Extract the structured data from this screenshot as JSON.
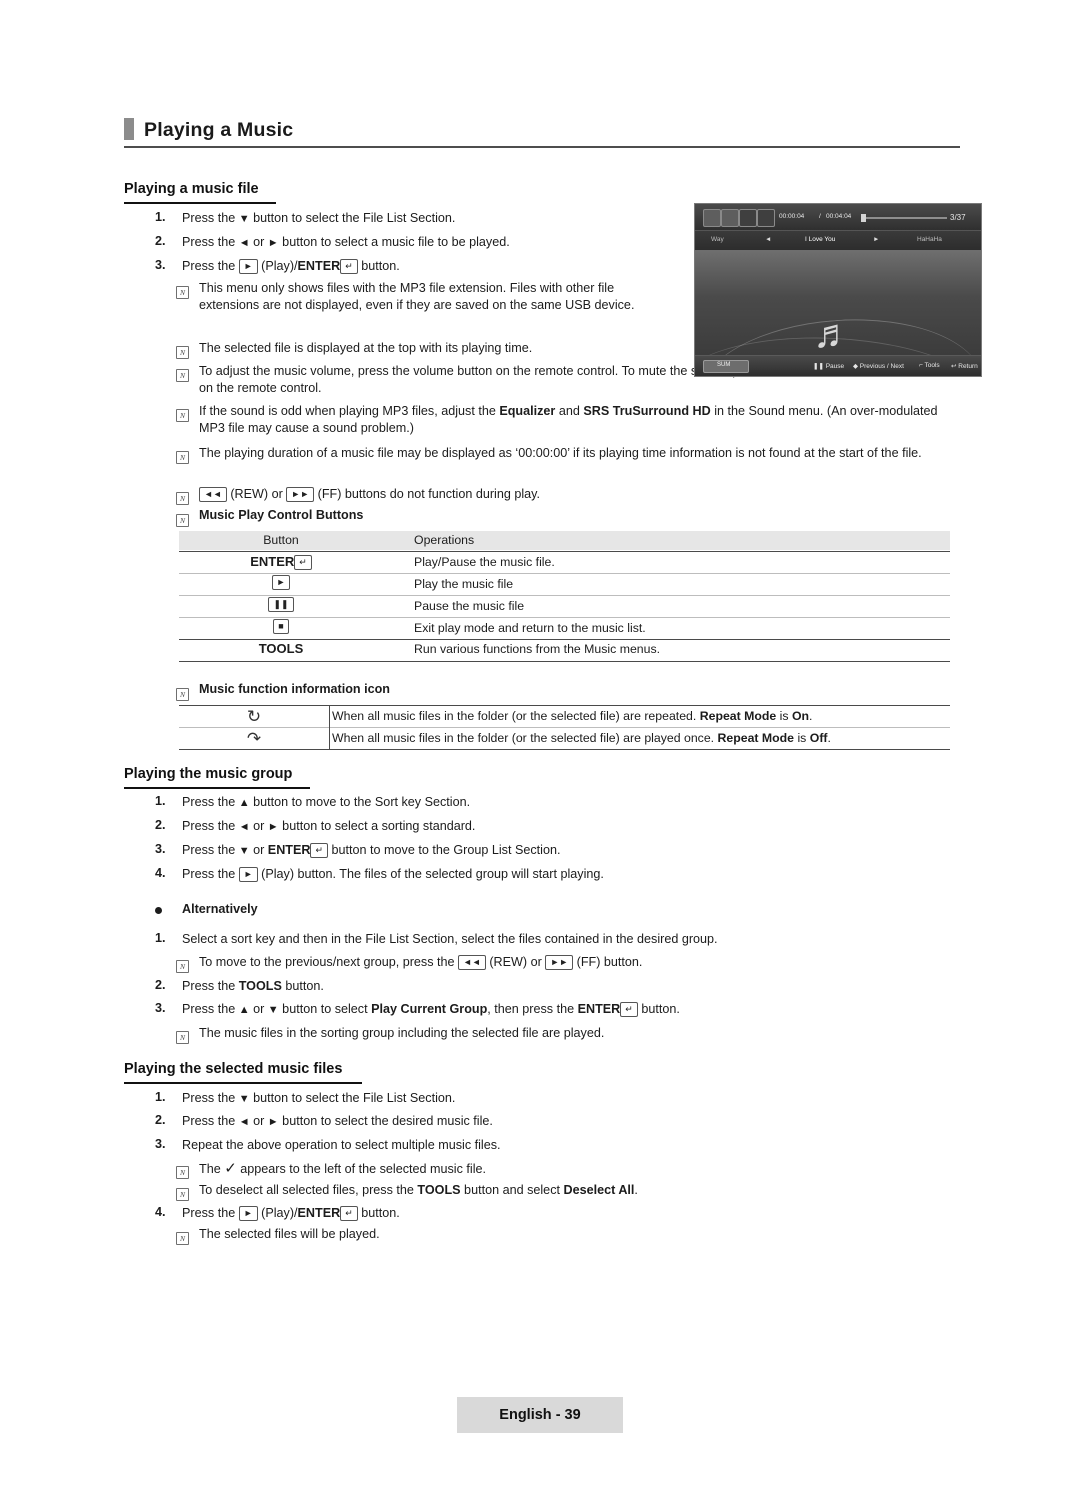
{
  "page": {
    "title": "Playing a Music",
    "footer_label": "English - 39"
  },
  "sections": {
    "music_file": {
      "heading": "Playing a music file",
      "steps": [
        "Press the ▼ button to select the File List Section.",
        "Press the ◄ or ► button to select a music file to be played.",
        "Press the ► (Play)/ENTER button."
      ],
      "notes": [
        "This menu only shows files with the MP3 file extension. Files with other file extensions are not displayed, even if they are saved on the same USB device.",
        "The selected file is displayed at the top with its playing time.",
        "To adjust the music volume, press the volume button on the remote control. To mute the sound, press the MUTE button on the remote control.",
        "If the sound is odd when playing MP3 files, adjust the Equalizer and SRS TruSurround HD in the Sound menu. (An over-modulated MP3 file may cause a sound problem.)",
        "The playing duration of a music file may be displayed as ‘00:00:00’ if its playing time information is not found at the start of the file.",
        "◄◄ (REW) or ►► (FF) buttons do not function during play."
      ]
    },
    "control_buttons": {
      "heading": "Music Play Control Buttons",
      "columns": [
        "Button",
        "Operations"
      ],
      "rows": [
        {
          "button": "ENTER",
          "operation": "Play/Pause the music file."
        },
        {
          "button": "►",
          "operation": "Play the music file"
        },
        {
          "button": "❚❚",
          "operation": "Pause the music file"
        },
        {
          "button": "■",
          "operation": "Exit play mode and return to the music list."
        },
        {
          "button": "TOOLS",
          "operation": "Run various functions from the Music menus."
        }
      ]
    },
    "info_icon": {
      "heading": "Music function information icon",
      "rows": [
        {
          "icon": "repeat-all-icon",
          "text": "When all music files in the folder (or the selected file) are repeated. Repeat Mode is On."
        },
        {
          "icon": "repeat-once-icon",
          "text": "When all music files in the folder (or the selected file) are played once. Repeat Mode is Off."
        }
      ]
    },
    "music_group": {
      "heading": "Playing the music group",
      "steps": [
        "Press the ▲ button to move to the Sort key Section.",
        "Press the ◄ or ► button to select a sorting standard.",
        "Press the ▼ or ENTER button to move to the Group List Section.",
        "Press the ► (Play) button. The files of the selected group will start playing."
      ],
      "alternatively_label": "Alternatively",
      "alt_steps": [
        "Select a sort key and then in the File List Section, select the files contained in the desired group.",
        "Press the TOOLS button.",
        "Press the ▲ or ▼ button to select Play Current Group, then press the ENTER button."
      ],
      "alt_notes": [
        "To move to the previous/next group, press the ◄◄ (REW) or ►► (FF) button.",
        "The music files in the sorting group including the selected file are played."
      ]
    },
    "selected_files": {
      "heading": "Playing the selected music files",
      "steps": [
        "Press the ▼ button to select the File List Section.",
        "Press the ◄ or ► button to select the desired music file.",
        "Repeat the above operation to select multiple music files.",
        "Press the ► (Play)/ENTER button."
      ],
      "notes": [
        "The ✓ appears to the left of the selected music file.",
        "To deselect all selected files, press the TOOLS button and select Deselect All.",
        "The selected files will be played."
      ]
    }
  },
  "screenshot": {
    "time_current": "00:00:04",
    "time_total": "00:04:04",
    "track_index": "3/37",
    "prev_label": "Way",
    "current_label": "I Love You",
    "next_label": "HaHaHa",
    "sum_label": "SUM",
    "controls": [
      "Pause",
      "Previous / Next",
      "Tools",
      "Return"
    ]
  }
}
